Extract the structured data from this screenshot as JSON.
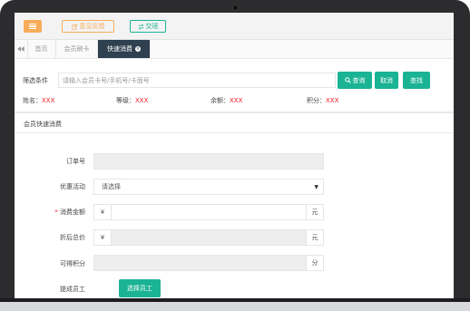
{
  "toolbar": {
    "menu_icon": "hamburger-menu-icon",
    "feedback_label": "意见反馈",
    "feedback_icon": "edit-icon",
    "shift_label": "交班",
    "shift_icon": "exchange-icon",
    "accent_orange": "#f8ac59",
    "accent_green": "#1ab394"
  },
  "tabs": {
    "nav_icon": "backward-icon",
    "items": [
      {
        "label": "首页"
      },
      {
        "label": "会员刷卡"
      },
      {
        "label": "快速消费",
        "active": true
      }
    ],
    "close_icon": "close-circle-icon",
    "active_color": "#2f4050"
  },
  "filter": {
    "label": "筛选条件",
    "placeholder": "请输入会员卡号/手机号/卡面号",
    "query_label": "查询",
    "cancel_label": "取消",
    "find_label": "查找"
  },
  "member": {
    "name_label": "姓名：",
    "name_value": "XXX",
    "level_label": "等级：",
    "level_value": "XXX",
    "balance_label": "余额：",
    "balance_value": "XXX",
    "points_label": "积分：",
    "points_value": "XXX"
  },
  "section": {
    "title": "会员快速消费"
  },
  "form": {
    "order_label": "订单号",
    "order_value": "",
    "promo_label": "优惠活动",
    "promo_value": "请选择",
    "amount_required": "*",
    "amount_label": "消费金额",
    "amount_prefix": "¥",
    "amount_suffix": "元",
    "discount_label": "折后总价",
    "discount_prefix": "¥",
    "discount_suffix": "元",
    "points_label": "可得积分",
    "points_suffix": "分",
    "staff_label": "提成员工",
    "staff_button": "选择员工"
  }
}
